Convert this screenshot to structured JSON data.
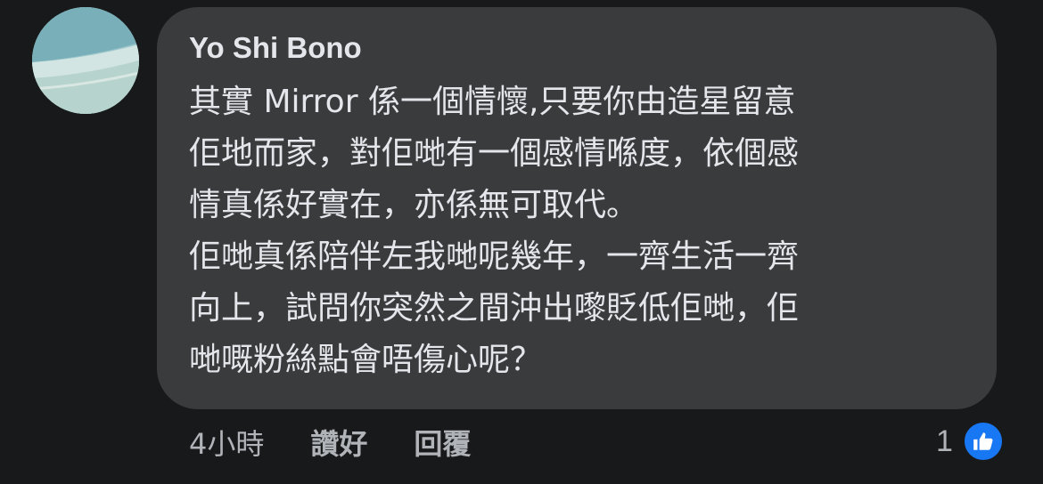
{
  "comment": {
    "author": "Yo Shi Bono",
    "lines": [
      "其實 Mirror 係一個情懷,只要你由造星留意",
      "佢地而家，對佢哋有一個感情喺度，依個感",
      "情真係好實在，亦係無可取代。",
      "佢哋真係陪伴左我哋呢幾年，一齊生活一齊",
      "向上，試問你突然之間沖出嚟貶低佢哋，佢",
      "哋嘅粉絲點會唔傷心呢？"
    ]
  },
  "actions": {
    "time": "4小時",
    "like_label": "讚好",
    "reply_label": "回覆"
  },
  "reactions": {
    "count": "1",
    "icon": "thumbs-up-icon",
    "badge_color": "#1877f2"
  },
  "colors": {
    "background": "#18191a",
    "bubble": "#3a3b3c",
    "primary_text": "#e4e6eb",
    "secondary_text": "#b0b3b8"
  }
}
